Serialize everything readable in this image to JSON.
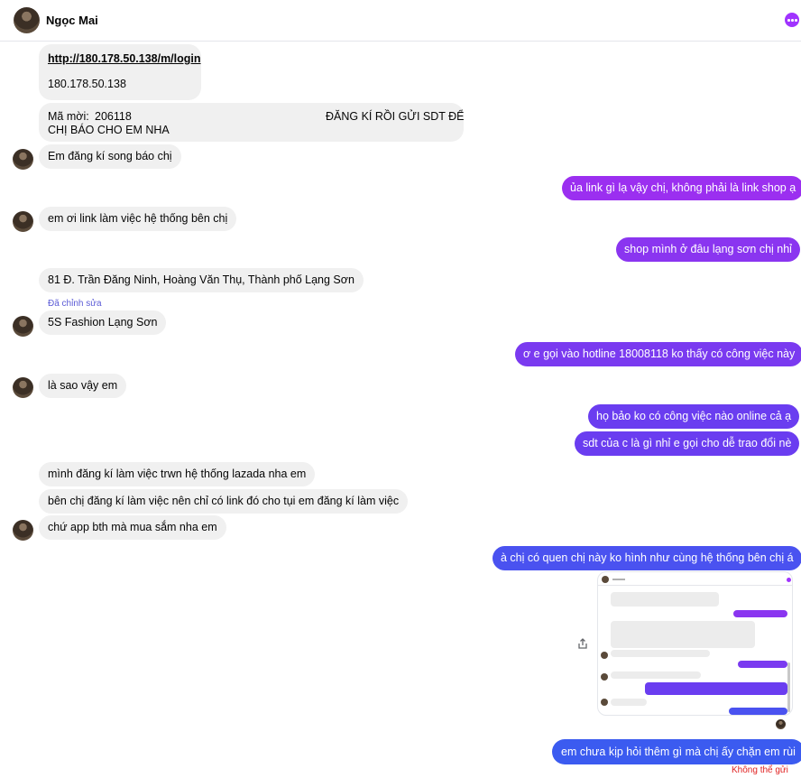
{
  "header": {
    "contact_name": "Ngọc Mai",
    "avatar_icon": "avatar",
    "more_icon": "more-options-icon",
    "accent": "#a033ff"
  },
  "messages": {
    "link_url": "http://180.178.50.138/m/login",
    "link_ip": "180.178.50.138",
    "invite_label": "Mã mời:",
    "invite_code": "206118",
    "invite_note_1": "ĐĂNG KÍ RỒI GỬI SDT ĐỂ",
    "invite_note_2": "CHỊ BÁO CHO EM NHA",
    "m1": "Em đăng kí song báo chị",
    "o1": "ủa link gì lạ vậy chị, không phải là link shop ạ",
    "m2": "em ơi link làm việc hệ thống bên chị",
    "o2": "shop mình ở đâu lạng sơn chị nhỉ",
    "m3": "81 Đ. Trần Đăng Ninh, Hoàng Văn Thụ, Thành phố Lạng Sơn",
    "edited": "Đã chỉnh sửa",
    "m4": "5S Fashion Lạng Sơn",
    "o3": "ơ e gọi vào hotline 18008118 ko thấy có công việc này",
    "m5": "là sao vậy em",
    "o4": "họ bảo ko có công việc nào online cả ạ",
    "o5": "sdt của c là gì nhỉ e gọi cho dễ trao đổi nè",
    "m6": "mình đăng kí làm việc trwn hệ thống lazada nha em",
    "m7": "bên chị đăng kí làm việc nên chỉ có link đó cho tụi em đăng kí làm việc",
    "m8": "chứ app bth mà mua sắm nha em",
    "o6": "à chị có quen chị này ko hình như cùng hệ thống bên chị á",
    "o7": "em chưa kịp hỏi thêm gì mà chị ấy chặn em rùi",
    "status": "Không thể gửi"
  },
  "icons": {
    "share": "share-icon",
    "screenshot": "screenshot-thumbnail"
  },
  "colors": {
    "incoming": "#f0f0f0",
    "out_purple": "#9b2ff0",
    "out_violet": "#6a3df0",
    "out_blue": "#3b5bf0",
    "error": "#e02020"
  }
}
